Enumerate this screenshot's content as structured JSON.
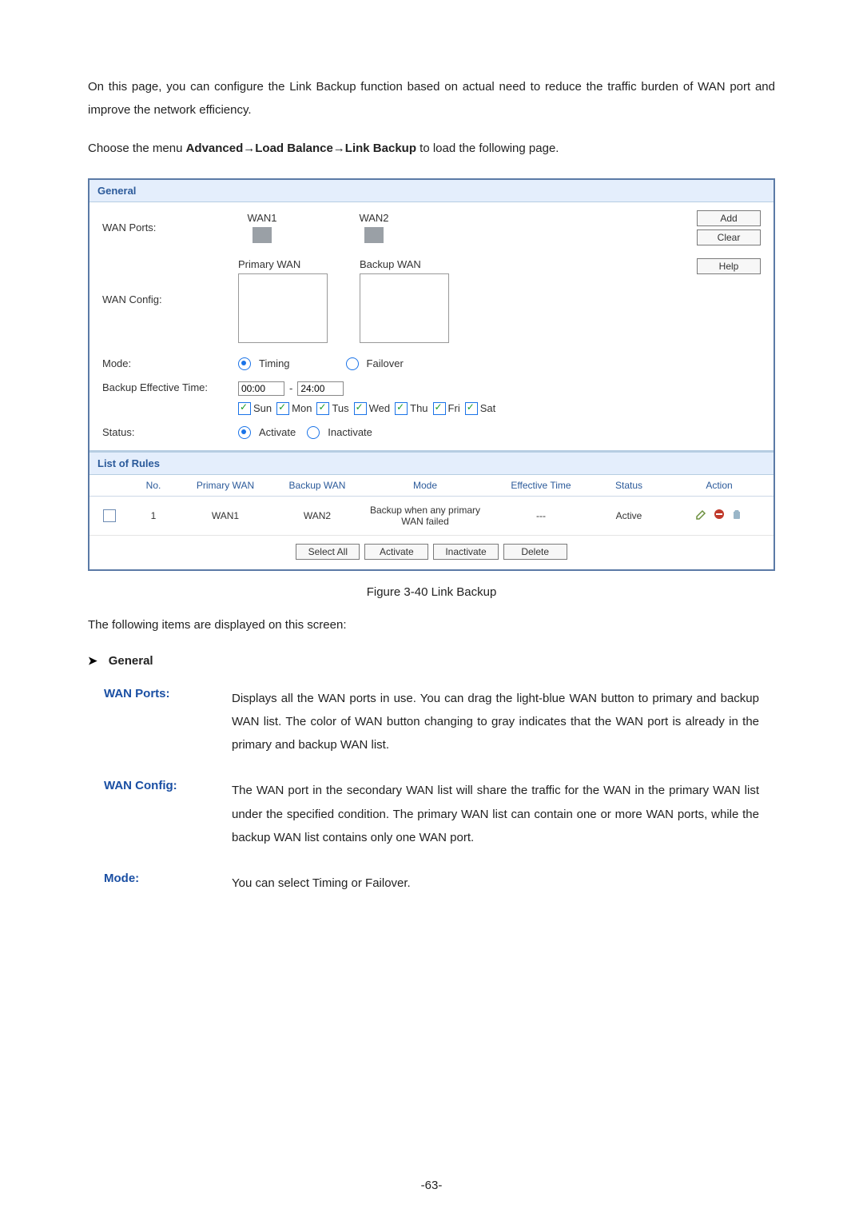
{
  "intro_text": "On this page, you can configure the Link Backup function based on actual need to reduce the traffic burden of WAN port and improve the network efficiency.",
  "nav_prefix": "Choose the menu ",
  "nav_path": "Advanced→Load Balance→Link Backup",
  "nav_suffix": " to load the following page.",
  "panel": {
    "general_header": "General",
    "labels": {
      "wan_ports": "WAN Ports:",
      "wan_config": "WAN Config:",
      "mode": "Mode:",
      "bet": "Backup Effective Time:",
      "status": "Status:"
    },
    "wan_ports": {
      "p1": "WAN1",
      "p2": "WAN2"
    },
    "wan_config": {
      "primary": "Primary WAN",
      "backup": "Backup WAN"
    },
    "buttons": {
      "add": "Add",
      "clear": "Clear",
      "help": "Help"
    },
    "mode": {
      "timing": "Timing",
      "failover": "Failover"
    },
    "bet": {
      "start": "00:00",
      "sep": "-",
      "end": "24:00"
    },
    "days": {
      "sun": "Sun",
      "mon": "Mon",
      "tus": "Tus",
      "wed": "Wed",
      "thu": "Thu",
      "fri": "Fri",
      "sat": "Sat"
    },
    "status": {
      "activate": "Activate",
      "inactivate": "Inactivate"
    },
    "rules_header": "List of Rules",
    "columns": {
      "no": "No.",
      "pw": "Primary WAN",
      "bw": "Backup WAN",
      "mode": "Mode",
      "et": "Effective Time",
      "st": "Status",
      "act": "Action"
    },
    "row1": {
      "no": "1",
      "pw": "WAN1",
      "bw": "WAN2",
      "mode": "Backup when any primary WAN failed",
      "et": "---",
      "st": "Active"
    },
    "table_buttons": {
      "select_all": "Select All",
      "activate": "Activate",
      "inactivate": "Inactivate",
      "delete": "Delete"
    }
  },
  "caption": "Figure 3-40 Link Backup",
  "items_intro": "The following items are displayed on this screen:",
  "section_general": "General",
  "defs": {
    "wan_ports": {
      "term": "WAN Ports:",
      "body": "Displays all the WAN ports in use. You can drag the light-blue WAN button to primary and backup WAN list. The color of WAN button changing to gray indicates that the WAN port is already in the primary and backup WAN list."
    },
    "wan_config": {
      "term": "WAN Config:",
      "body": "The WAN port in the secondary WAN list will share the traffic for the WAN in the primary WAN list under the specified condition. The primary WAN list can contain one or more WAN ports, while the backup WAN list contains only one WAN port."
    },
    "mode": {
      "term": "Mode:",
      "body": "You can select Timing or Failover."
    }
  },
  "page_number": "-63-"
}
